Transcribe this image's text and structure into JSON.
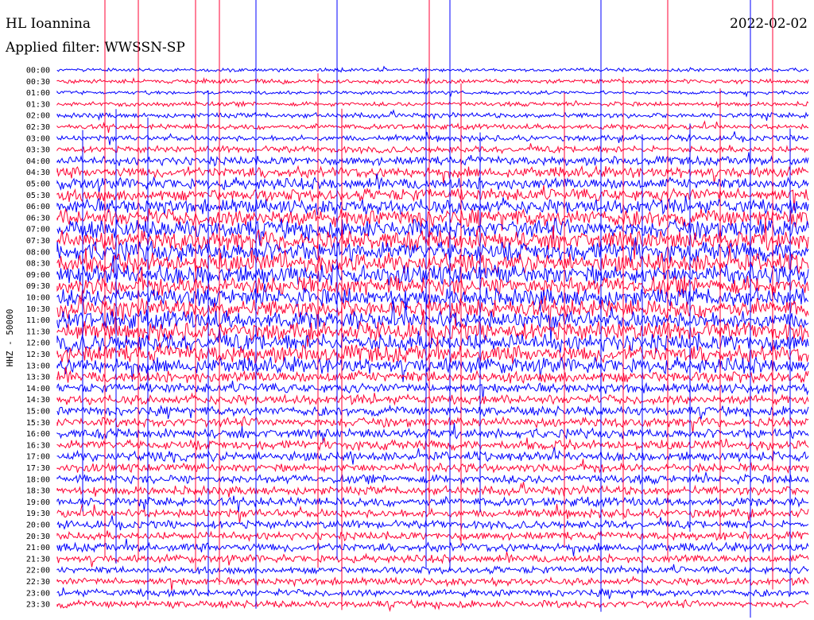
{
  "header": {
    "station": "HL Ioannina",
    "date": "2022-02-02",
    "filter": "Applied filter: WWSSN-SP"
  },
  "chart_data": {
    "type": "line",
    "title": "HL Ioannina",
    "subtitle": "Applied filter: WWSSN-SP",
    "ylabel": "HHZ - 50000",
    "xlabel": "",
    "grid": false,
    "colors": [
      "#0000ff",
      "#ff0033"
    ],
    "row_labels": [
      "00:00",
      "00:30",
      "01:00",
      "01:30",
      "02:00",
      "02:30",
      "03:00",
      "03:30",
      "04:00",
      "04:30",
      "05:00",
      "05:30",
      "06:00",
      "06:30",
      "07:00",
      "07:30",
      "08:00",
      "08:30",
      "09:00",
      "09:30",
      "10:00",
      "10:30",
      "11:00",
      "11:30",
      "12:00",
      "12:30",
      "13:00",
      "13:30",
      "14:00",
      "14:30",
      "15:00",
      "15:30",
      "16:00",
      "16:30",
      "17:00",
      "17:30",
      "18:00",
      "18:30",
      "19:00",
      "19:30",
      "20:00",
      "20:30",
      "21:00",
      "21:30",
      "22:00",
      "22:30",
      "23:00",
      "23:30"
    ],
    "relative_amplitude": [
      0.25,
      0.3,
      0.25,
      0.3,
      0.35,
      0.35,
      0.4,
      0.45,
      0.6,
      0.75,
      0.8,
      0.85,
      1.0,
      1.2,
      1.3,
      1.35,
      1.35,
      1.35,
      1.35,
      1.3,
      1.25,
      1.25,
      1.25,
      1.25,
      1.2,
      1.2,
      1.1,
      0.8,
      0.65,
      0.65,
      0.65,
      0.65,
      0.65,
      0.65,
      0.65,
      0.6,
      0.6,
      0.6,
      0.6,
      0.6,
      0.55,
      0.55,
      0.6,
      0.55,
      0.5,
      0.5,
      0.5,
      0.5
    ]
  }
}
